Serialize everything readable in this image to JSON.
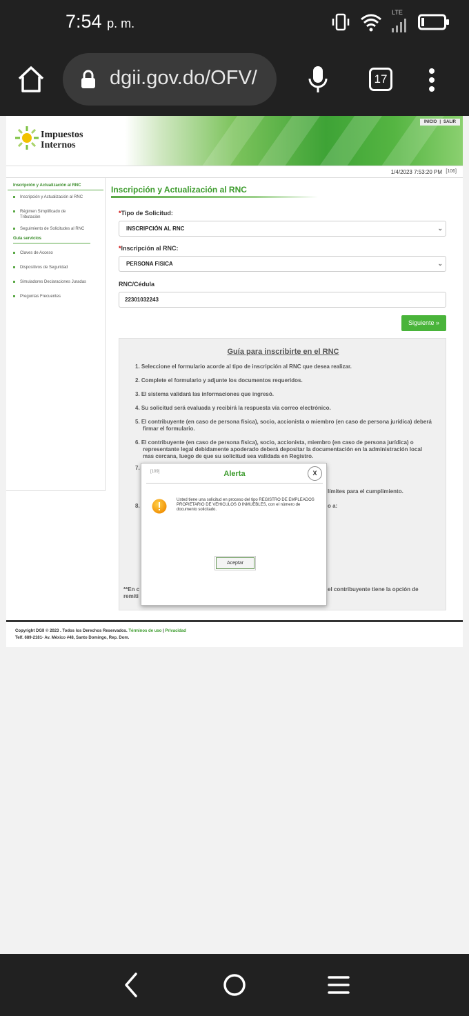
{
  "status_bar": {
    "time": "7:54",
    "ampm": "p. m.",
    "network": "LTE"
  },
  "browser": {
    "url": "dgii.gov.do/OFV/",
    "tab_count": "17"
  },
  "site": {
    "logo_line1": "Impuestos",
    "logo_line2": "Internos",
    "top_links": [
      "INICIO",
      "|",
      "SALIR"
    ],
    "datetime": "1/4/2023 7:53:20 PM",
    "session_code": "[106]"
  },
  "sidebar": {
    "section1_title": "Inscripción y Actualización al RNC",
    "section1_items": [
      "Inscripción y Actualización al RNC",
      "Régimen Simplificado de Tributación",
      "Seguimiento de Solicitudes al RNC"
    ],
    "section2_title": "Guía servicios",
    "section2_items": [
      "Claves de Acceso",
      "Dispositivos de Seguridad",
      "Simuladores Declaraciones Juradas",
      "Preguntas Frecuentes"
    ]
  },
  "form": {
    "title": "Inscripción y Actualización al RNC",
    "required_mark": "*",
    "tipo_label": "Tipo de Solicitud:",
    "tipo_value": "INSCRIPCIÓN AL RNC",
    "inscripcion_label": "Inscripción al RNC:",
    "inscripcion_value": "PERSONA FISICA",
    "rnc_label": "RNC/Cédula",
    "rnc_value": "22301032243",
    "next_button": "Siguiente »"
  },
  "guide": {
    "title": "Guía para inscribirte en el RNC",
    "items": [
      "1. Seleccione el formulario acorde al tipo de inscripción al RNC que desea realizar.",
      "2. Complete el formulario y adjunte los documentos requeridos.",
      "3. El sistema validará las informaciones que ingresó.",
      "4. Su solicitud será evaluada y recibirá la respuesta vía correo electrónico.",
      "5. El contribuyente (en caso de persona física), socio, accionista o miembro (en caso de persona jurídica) deberá firmar el formulario.",
      "6. El contribuyente (en caso de persona física), socio, accionista, miembro (en caso de persona jurídica) o representante legal debidamente apoderado deberá depositar la documentación en la administración local mas cercana, luego de que su solicitud sea validada en Registro."
    ],
    "item7_visible": "7.",
    "item7_tail": "límites para el cumplimiento.",
    "item8_visible": "8.",
    "item8_tail": "o a:",
    "note_start": "**En c",
    "note_start2": "remiti",
    "note_tail": "el contribuyente tiene la opción de"
  },
  "footer": {
    "copyright": "Copyright DGII © 2023 . Todos los Derechos Reservados.",
    "terms": "Términos de uso",
    "sep": "|",
    "privacy": "Privacidad",
    "address": "Telf. 689-2181- Av. México #48, Santo Domingo, Rep. Dom."
  },
  "alert": {
    "code": "[109]",
    "title": "Alerta",
    "close": "X",
    "message": "Usted tiene una solicitud en proceso del tipo REGISTRO DE EMPLEADOS PROPIETARIO DE VEHICULOS O INMUEBLES, con el número de documento solicitado.",
    "accept": "Aceptar"
  },
  "colors": {
    "brand_green": "#3a9a2a",
    "button_green": "#49b43a",
    "dark_chrome": "#212121",
    "warning_orange": "#f5a300"
  }
}
